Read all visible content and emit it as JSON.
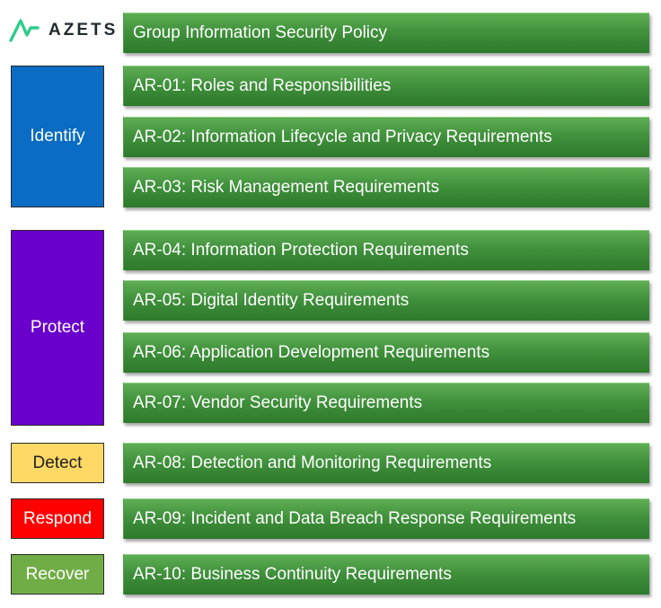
{
  "logo": {
    "text": "AZETS",
    "icon": "azets-logo-icon",
    "colors": {
      "mark": "#2ecc8a",
      "text": "#1f2a2e"
    }
  },
  "policy": {
    "label": "Group Information Security Policy"
  },
  "categories": [
    {
      "key": "identify",
      "label": "Identify",
      "color": "#0a6cc2"
    },
    {
      "key": "protect",
      "label": "Protect",
      "color": "#6a00cc"
    },
    {
      "key": "detect",
      "label": "Detect",
      "color": "#ffd966"
    },
    {
      "key": "respond",
      "label": "Respond",
      "color": "#ff0000"
    },
    {
      "key": "recover",
      "label": "Recover",
      "color": "#70ad47"
    }
  ],
  "requirements": [
    {
      "label": "AR-01: Roles and Responsibilities"
    },
    {
      "label": "AR-02: Information Lifecycle and Privacy Requirements"
    },
    {
      "label": "AR-03: Risk Management Requirements"
    },
    {
      "label": "AR-04: Information Protection Requirements"
    },
    {
      "label": "AR-05: Digital Identity Requirements"
    },
    {
      "label": "AR-06: Application Development Requirements"
    },
    {
      "label": "AR-07: Vendor Security Requirements"
    },
    {
      "label": "AR-08: Detection and Monitoring Requirements"
    },
    {
      "label": "AR-09: Incident and Data Breach Response Requirements"
    },
    {
      "label": "AR-10: Business Continuity Requirements"
    }
  ],
  "theme": {
    "requirement_color": "#3f8f3b"
  }
}
